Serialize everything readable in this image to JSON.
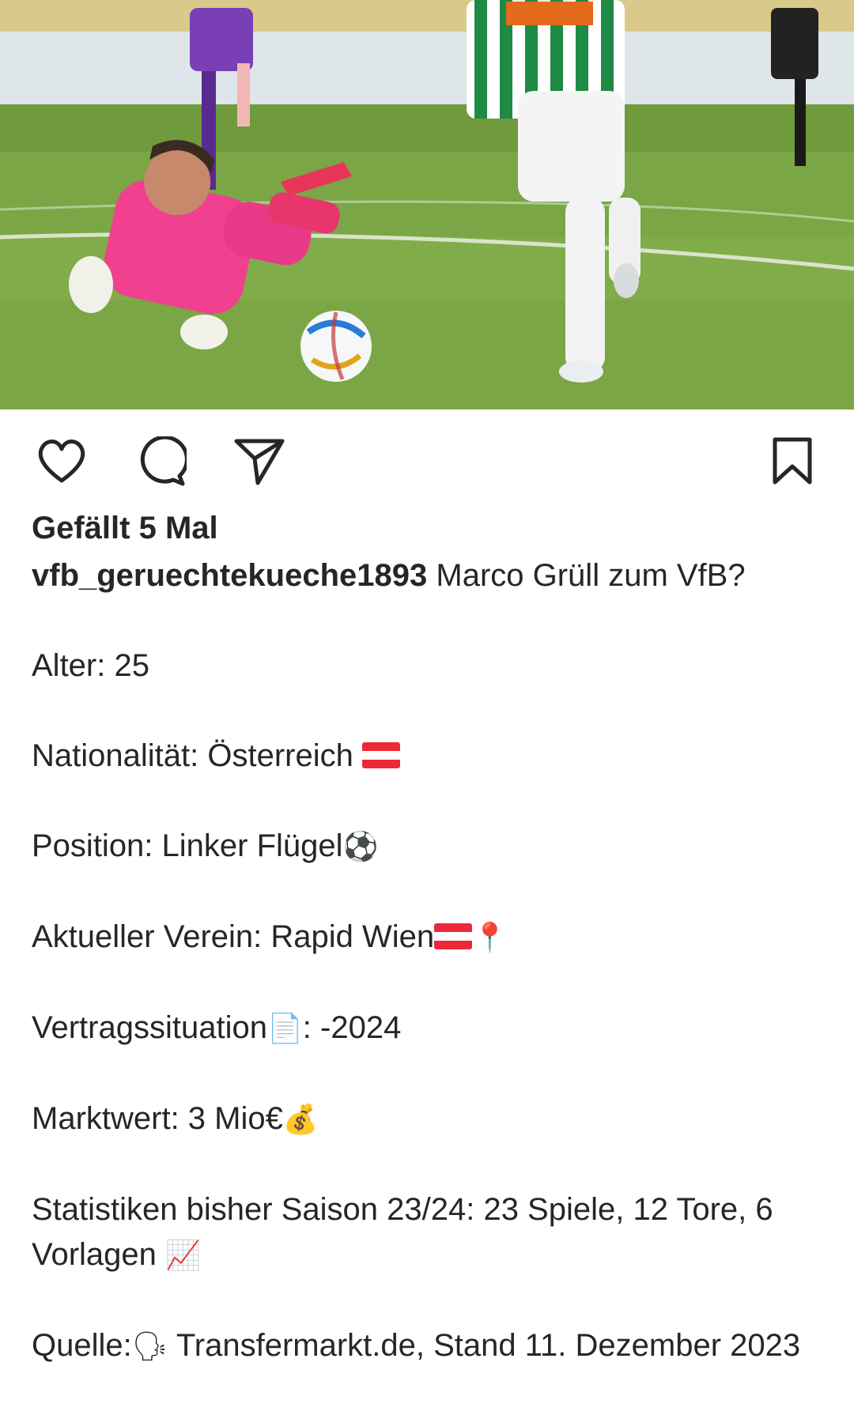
{
  "post": {
    "image_alt": "Football match photo"
  },
  "actions": {
    "like_icon": "heart-icon",
    "comment_icon": "comment-icon",
    "share_icon": "send-icon",
    "save_icon": "bookmark-icon"
  },
  "likes": {
    "text": "Gefällt 5 Mal"
  },
  "caption": {
    "username": "vfb_geruechtekueche1893",
    "headline": " Marco Grüll zum VfB?",
    "age": "Alter: 25",
    "nationality": "Nationalität:  Österreich ",
    "position": "Position:  Linker Flügel",
    "position_emoji": "⚽",
    "club": "Aktueller Verein:  Rapid Wien",
    "club_emoji": "📍",
    "contract": "Vertragssituation",
    "contract_emoji": "📄",
    "contract_value": ": -2024",
    "market_value": "Marktwert:  3 Mio€",
    "market_value_emoji": "💰",
    "stats": "Statistiken bisher Saison 23/24:  23 Spiele, 12 Tore, 6 Vorlagen ",
    "stats_emoji": "📈",
    "source_label": "Quelle:",
    "source_emoji": "🗣",
    "source": " Transfermarkt.de, Stand 11. Dezember 2023"
  }
}
